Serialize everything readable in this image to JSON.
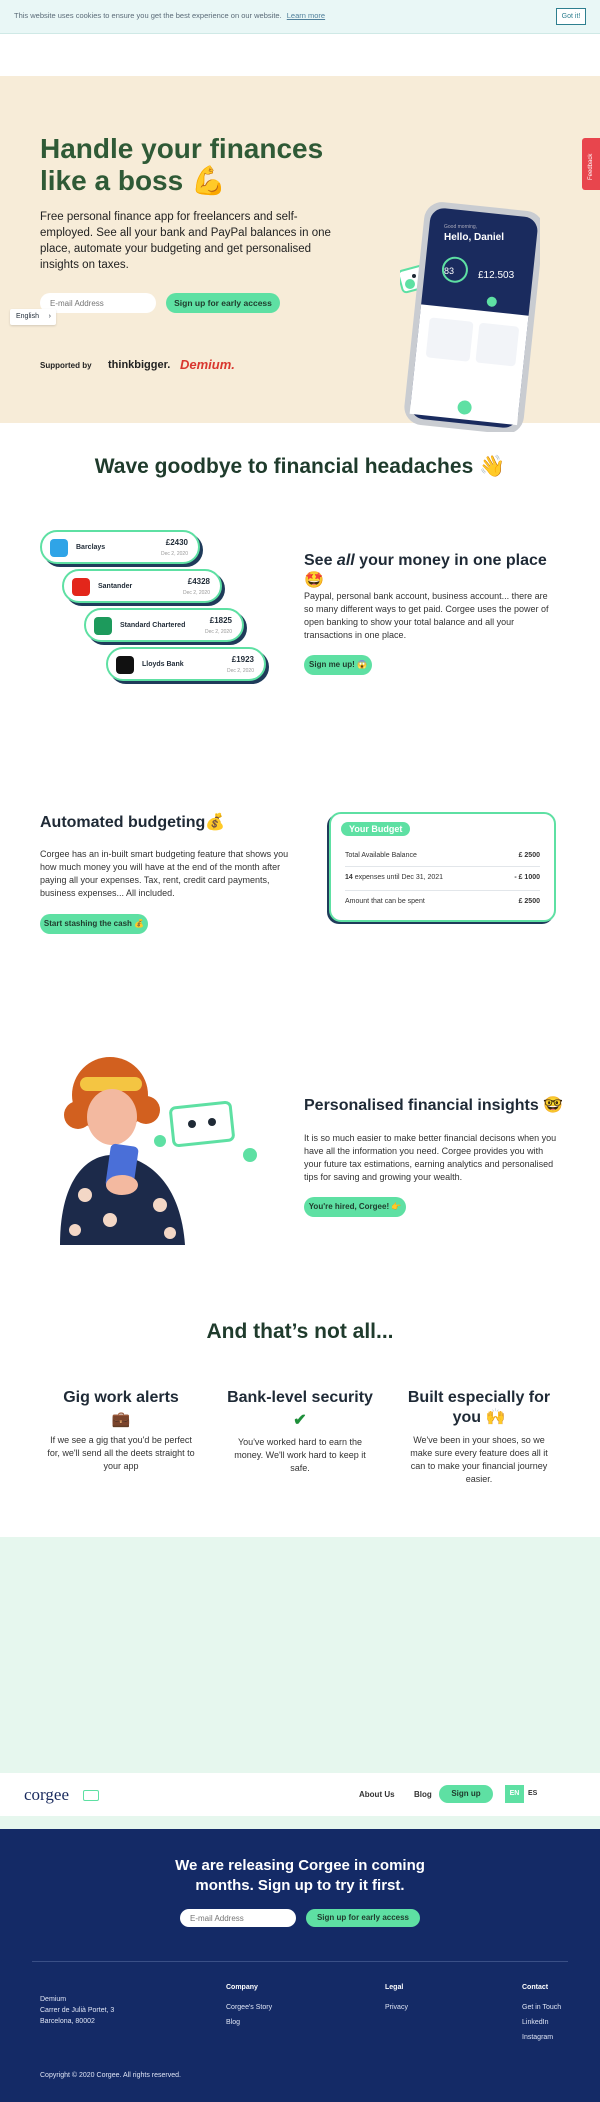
{
  "cookie": {
    "message": "This website uses cookies to ensure you get the best experience on our website.",
    "learn_more": "Learn more",
    "got_it": "Got it!"
  },
  "hero": {
    "title_line1": "Handle your finances",
    "title_line2": "like a boss",
    "description": "Free personal finance app for freelancers and self-employed. See all your bank and PayPal balances in one place, automate your budgeting and get personalised insights on taxes.",
    "email_placeholder": "E-mail Address",
    "cta": "Sign up for early access",
    "language": "English",
    "supported_by": "Supported by",
    "sponsor1": "thinkbigger.",
    "sponsor2": "Demium.",
    "feedback": "Feedback"
  },
  "phone": {
    "greeting": "Good morning,",
    "name": "Hello, Daniel",
    "score": "83",
    "balance": "£12.503"
  },
  "wave": {
    "title": "Wave goodbye to financial headaches 👋",
    "banks": [
      {
        "name": "Barclays",
        "amount": "£2430",
        "date": "Dec 2, 2020",
        "color": "#2fa4e7"
      },
      {
        "name": "Santander",
        "amount": "£4328",
        "date": "Dec 2, 2020",
        "color": "#e3261b"
      },
      {
        "name": "Standard Chartered",
        "amount": "£1825",
        "date": "Dec 2, 2020",
        "color": "#1d9a5c"
      },
      {
        "name": "Lloyds Bank",
        "amount": "£1923",
        "date": "Dec 2, 2020",
        "color": "#111111"
      }
    ],
    "heading_pre": "See ",
    "heading_em": "all",
    "heading_post": " your money in one place 🤩",
    "text": "Paypal, personal bank account, business account... there are so many different ways to get paid. Corgee uses the power of open banking to show your total balance and all your transactions in one place.",
    "button": "Sign me up! 😱"
  },
  "budget": {
    "heading": "Automated budgeting💰",
    "text": "Corgee has an in-built smart budgeting feature that shows you how much money you will have at the end of the month after paying all your expenses. Tax, rent, credit card payments, business expenses... All included.",
    "button": "Start stashing the cash 💰",
    "card_title": "Your Budget",
    "rows": [
      {
        "label": "Total Available Balance",
        "value": "£ 2500"
      },
      {
        "label_bold": "14",
        "label": " expenses until Dec 31, 2021",
        "value": "- £ 1000"
      },
      {
        "label": "Amount that can be spent",
        "value": "£ 2500"
      }
    ]
  },
  "insights": {
    "heading": "Personalised financial insights 🤓",
    "text": "It is so much easier to make better financial decisons when you have all the information you need. Corgee provides you with your future tax estimations, earning analytics and personalised tips for saving and growing your wealth.",
    "button": "You're hired, Corgee! 👉"
  },
  "more": {
    "title": "And that’s not all...",
    "features": [
      {
        "title": "Gig work alerts",
        "emoji": "💼",
        "text": "If we see a gig that you'd be perfect for, we'll send all the deets straight to your app"
      },
      {
        "title": "Bank-level security",
        "emoji": "✔",
        "text": "You've worked hard to earn the money. We'll work hard to keep it safe."
      },
      {
        "title": "Built especially for you 🙌",
        "emoji": "",
        "text": "We've been in your shoes, so we make sure every feature does all it can to make your financial journey easier."
      }
    ]
  },
  "nav": {
    "logo": "corgee",
    "about": "About Us",
    "blog": "Blog",
    "signup": "Sign up",
    "en": "EN",
    "es": "ES"
  },
  "footer": {
    "headline": "We are releasing Corgee in coming months. Sign up to try it first.",
    "email_placeholder": "E-mail Address",
    "cta": "Sign up for early access",
    "address1": "Demium",
    "address2": "Carrer de Julià Portet, 3",
    "address3": "Barcelona, 80002",
    "company_h": "Company",
    "company_links": [
      "Corgee's Story",
      "Blog"
    ],
    "legal_h": "Legal",
    "legal_links": [
      "Privacy"
    ],
    "contact_h": "Contact",
    "contact_links": [
      "Get in Touch",
      "LinkedIn",
      "Instagram"
    ],
    "copyright": "Copyright © 2020 Corgee. All rights reserved."
  }
}
